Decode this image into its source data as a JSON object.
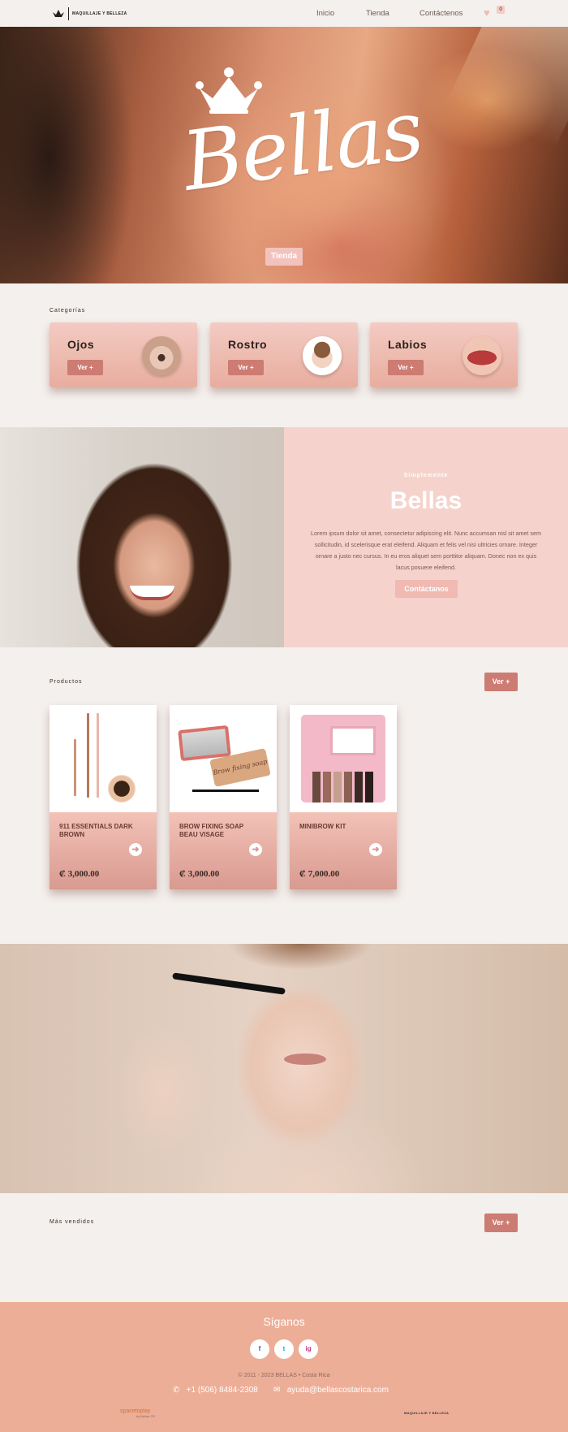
{
  "nav": {
    "brand": "MAQUILLAJE Y BELLEZA",
    "links": [
      "Inicio",
      "Tienda",
      "Contáctenos"
    ],
    "cart_count": "0"
  },
  "hero": {
    "script_title": "Bellas",
    "shop_button": "Tienda"
  },
  "categories": {
    "label": "Categorías",
    "items": [
      {
        "title": "Ojos",
        "button": "Ver +"
      },
      {
        "title": "Rostro",
        "button": "Ver +"
      },
      {
        "title": "Labios",
        "button": "Ver +"
      }
    ]
  },
  "about": {
    "eyebrow": "Simplemente",
    "headline": "Bellas",
    "body": "Lorem ipsum dolor sit amet, consectetur adipiscing elit. Nunc accumsan nisl sit amet sem sollicitudin, id scelerisque erat eleifend. Aliquam et felis vel nisi ultricies ornare. Integer ornare a justo nec cursus. In eu eros aliquet sem porttitor aliquam. Donec non ex quis lacus posuere eleifend.",
    "cta": "Contáctanos"
  },
  "products": {
    "label": "Productos",
    "ver_button": "Ver +",
    "items": [
      {
        "name": "911 ESSENTIALS DARK BROWN",
        "price": "₡ 3,000.00"
      },
      {
        "name": "BROW FIXING SOAP BEAU VISAGE",
        "price": "₡ 3,000.00",
        "tin_text": "Brow fixing soap"
      },
      {
        "name": "MINIBROW KIT",
        "price": "₡ 7,000.00"
      }
    ]
  },
  "best_sellers": {
    "label": "Más vendidos",
    "ver_button": "Ver +"
  },
  "footer": {
    "follow": "Síganos",
    "social": [
      "f",
      "t",
      "ig"
    ],
    "copyright": "© 2011 - 2023 BELLAS • Costa Rica",
    "phone": "+1 (506) 8484-2308",
    "email": "ayuda@bellascostarica.com",
    "credit": "spacetoplay",
    "credit_sub": "by Bellas CR",
    "foot_logo": "MAQUILLAJE Y BELLEZA"
  },
  "colors": {
    "accent": "#cc7c72",
    "blush": "#f5d3cc",
    "footer": "#edae98",
    "background": "#f4f0ed"
  }
}
